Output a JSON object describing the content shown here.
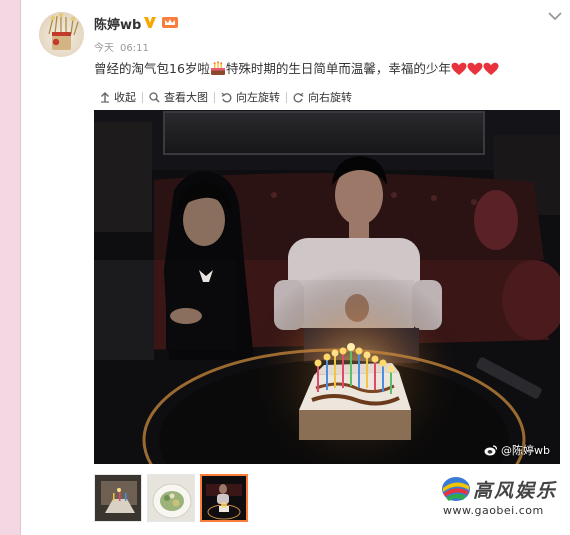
{
  "post": {
    "username": "陈婷wb",
    "time_label": "今天",
    "time_value": "06:11",
    "text_before": "曾经的淘气包16岁啦",
    "text_after": "特殊时期的生日简单而温馨，幸福的少年",
    "heart_count": 3
  },
  "toolbar": {
    "collapse": "收起",
    "view_large": "查看大图",
    "rotate_left": "向左旋转",
    "rotate_right": "向右旋转"
  },
  "photo": {
    "watermark": "@陈婷wb"
  },
  "thumbnails": {
    "count": 3,
    "selected_index": 2
  },
  "brand": {
    "name": "高风娱乐",
    "url": "www.gaobei.com"
  },
  "icons": {
    "avatar": "avatar-photo",
    "verified": "verified-v-icon",
    "member": "member-crown-icon",
    "expand": "chevron-down-icon",
    "cake": "birthday-cake-icon",
    "heart": "red-heart-icon",
    "collapse": "collapse-arrow-icon",
    "view": "magnifier-icon",
    "rotate_left": "rotate-left-icon",
    "rotate_right": "rotate-right-icon",
    "weibo": "weibo-logo-icon"
  },
  "colors": {
    "heart": "#e8333c",
    "verified": "#f7a700",
    "selected_border": "#fa7d3c",
    "side_strip": "#f3d7e2"
  }
}
